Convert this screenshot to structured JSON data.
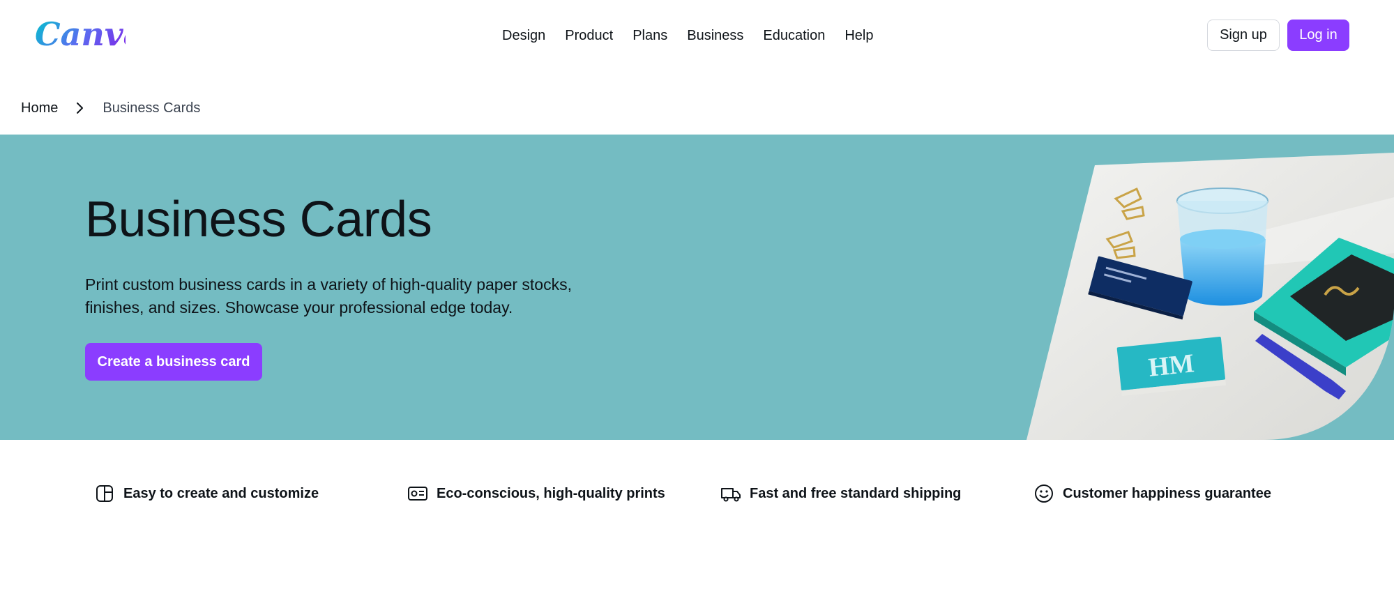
{
  "brand": {
    "name": "Canva",
    "accent": "#8b3dff",
    "hero_bg": "#74bcc2"
  },
  "nav": {
    "items": [
      {
        "label": "Design"
      },
      {
        "label": "Product"
      },
      {
        "label": "Plans"
      },
      {
        "label": "Business"
      },
      {
        "label": "Education"
      },
      {
        "label": "Help"
      }
    ],
    "signup_label": "Sign up",
    "login_label": "Log in"
  },
  "breadcrumb": {
    "home": "Home",
    "current": "Business Cards",
    "separator_icon": "chevron-right-icon"
  },
  "hero": {
    "title": "Business Cards",
    "description": "Print custom business cards in a variety of high-quality paper stocks, finishes, and sizes. Showcase your professional edge today.",
    "cta_label": "Create a business card",
    "image_label": "HM"
  },
  "features": [
    {
      "icon": "layout-panel-icon",
      "label": "Easy to create and customize"
    },
    {
      "icon": "id-card-icon",
      "label": "Eco-conscious, high-quality prints"
    },
    {
      "icon": "truck-icon",
      "label": "Fast and free standard shipping"
    },
    {
      "icon": "smiley-icon",
      "label": "Customer happiness guarantee"
    }
  ]
}
